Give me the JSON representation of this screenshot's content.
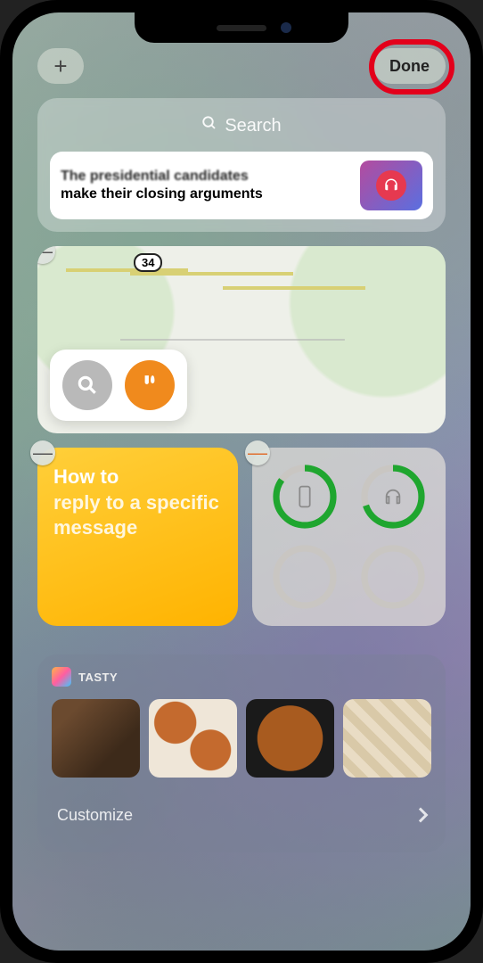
{
  "topbar": {
    "add_label": "+",
    "done_label": "Done"
  },
  "search": {
    "placeholder": "Search",
    "news_line1": "The presidential candidates",
    "news_line2": "make their closing arguments"
  },
  "map": {
    "route_label": "34"
  },
  "note": {
    "line1": "How to",
    "rest": "reply to a specific message"
  },
  "batteries": {
    "phone_pct": 85,
    "headphones_pct": 70
  },
  "tasty": {
    "title": "TASTY"
  },
  "footer": {
    "customize_label": "Customize"
  },
  "annotation": {
    "highlight_target": "done-button"
  }
}
